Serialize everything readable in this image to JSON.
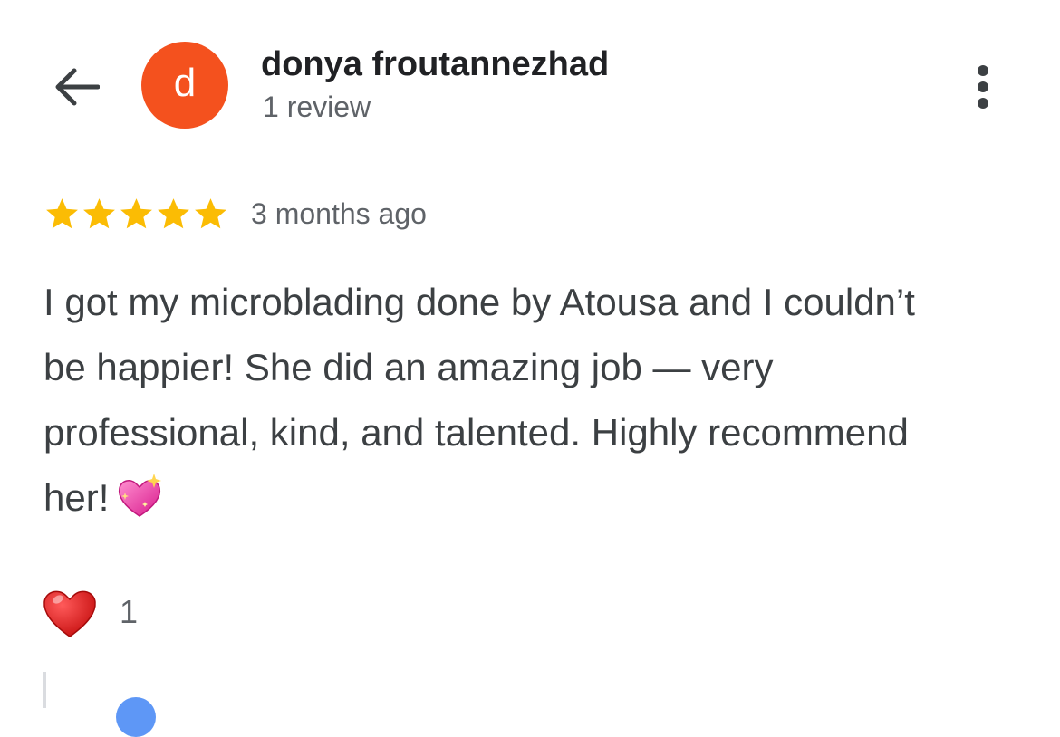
{
  "header": {
    "back_icon": "arrow-left-icon",
    "avatar_letter": "d",
    "avatar_color": "#f4511e",
    "reviewer_name": "donya froutannezhad",
    "review_count": "1 review",
    "more_icon": "more-vertical-icon"
  },
  "review": {
    "rating": 5,
    "rating_max": 5,
    "star_color": "#fbbc04",
    "time_ago": "3 months ago",
    "text": "I got my microblading done by Atousa and I couldn’t be happier! She did an amazing job — very professional, kind, and talented. Highly recommend her!",
    "text_emoji": "sparkling-heart-emoji"
  },
  "reactions": {
    "icon": "red-heart-icon",
    "count": "1"
  },
  "reply": {
    "avatar_color": "#4285f4"
  }
}
